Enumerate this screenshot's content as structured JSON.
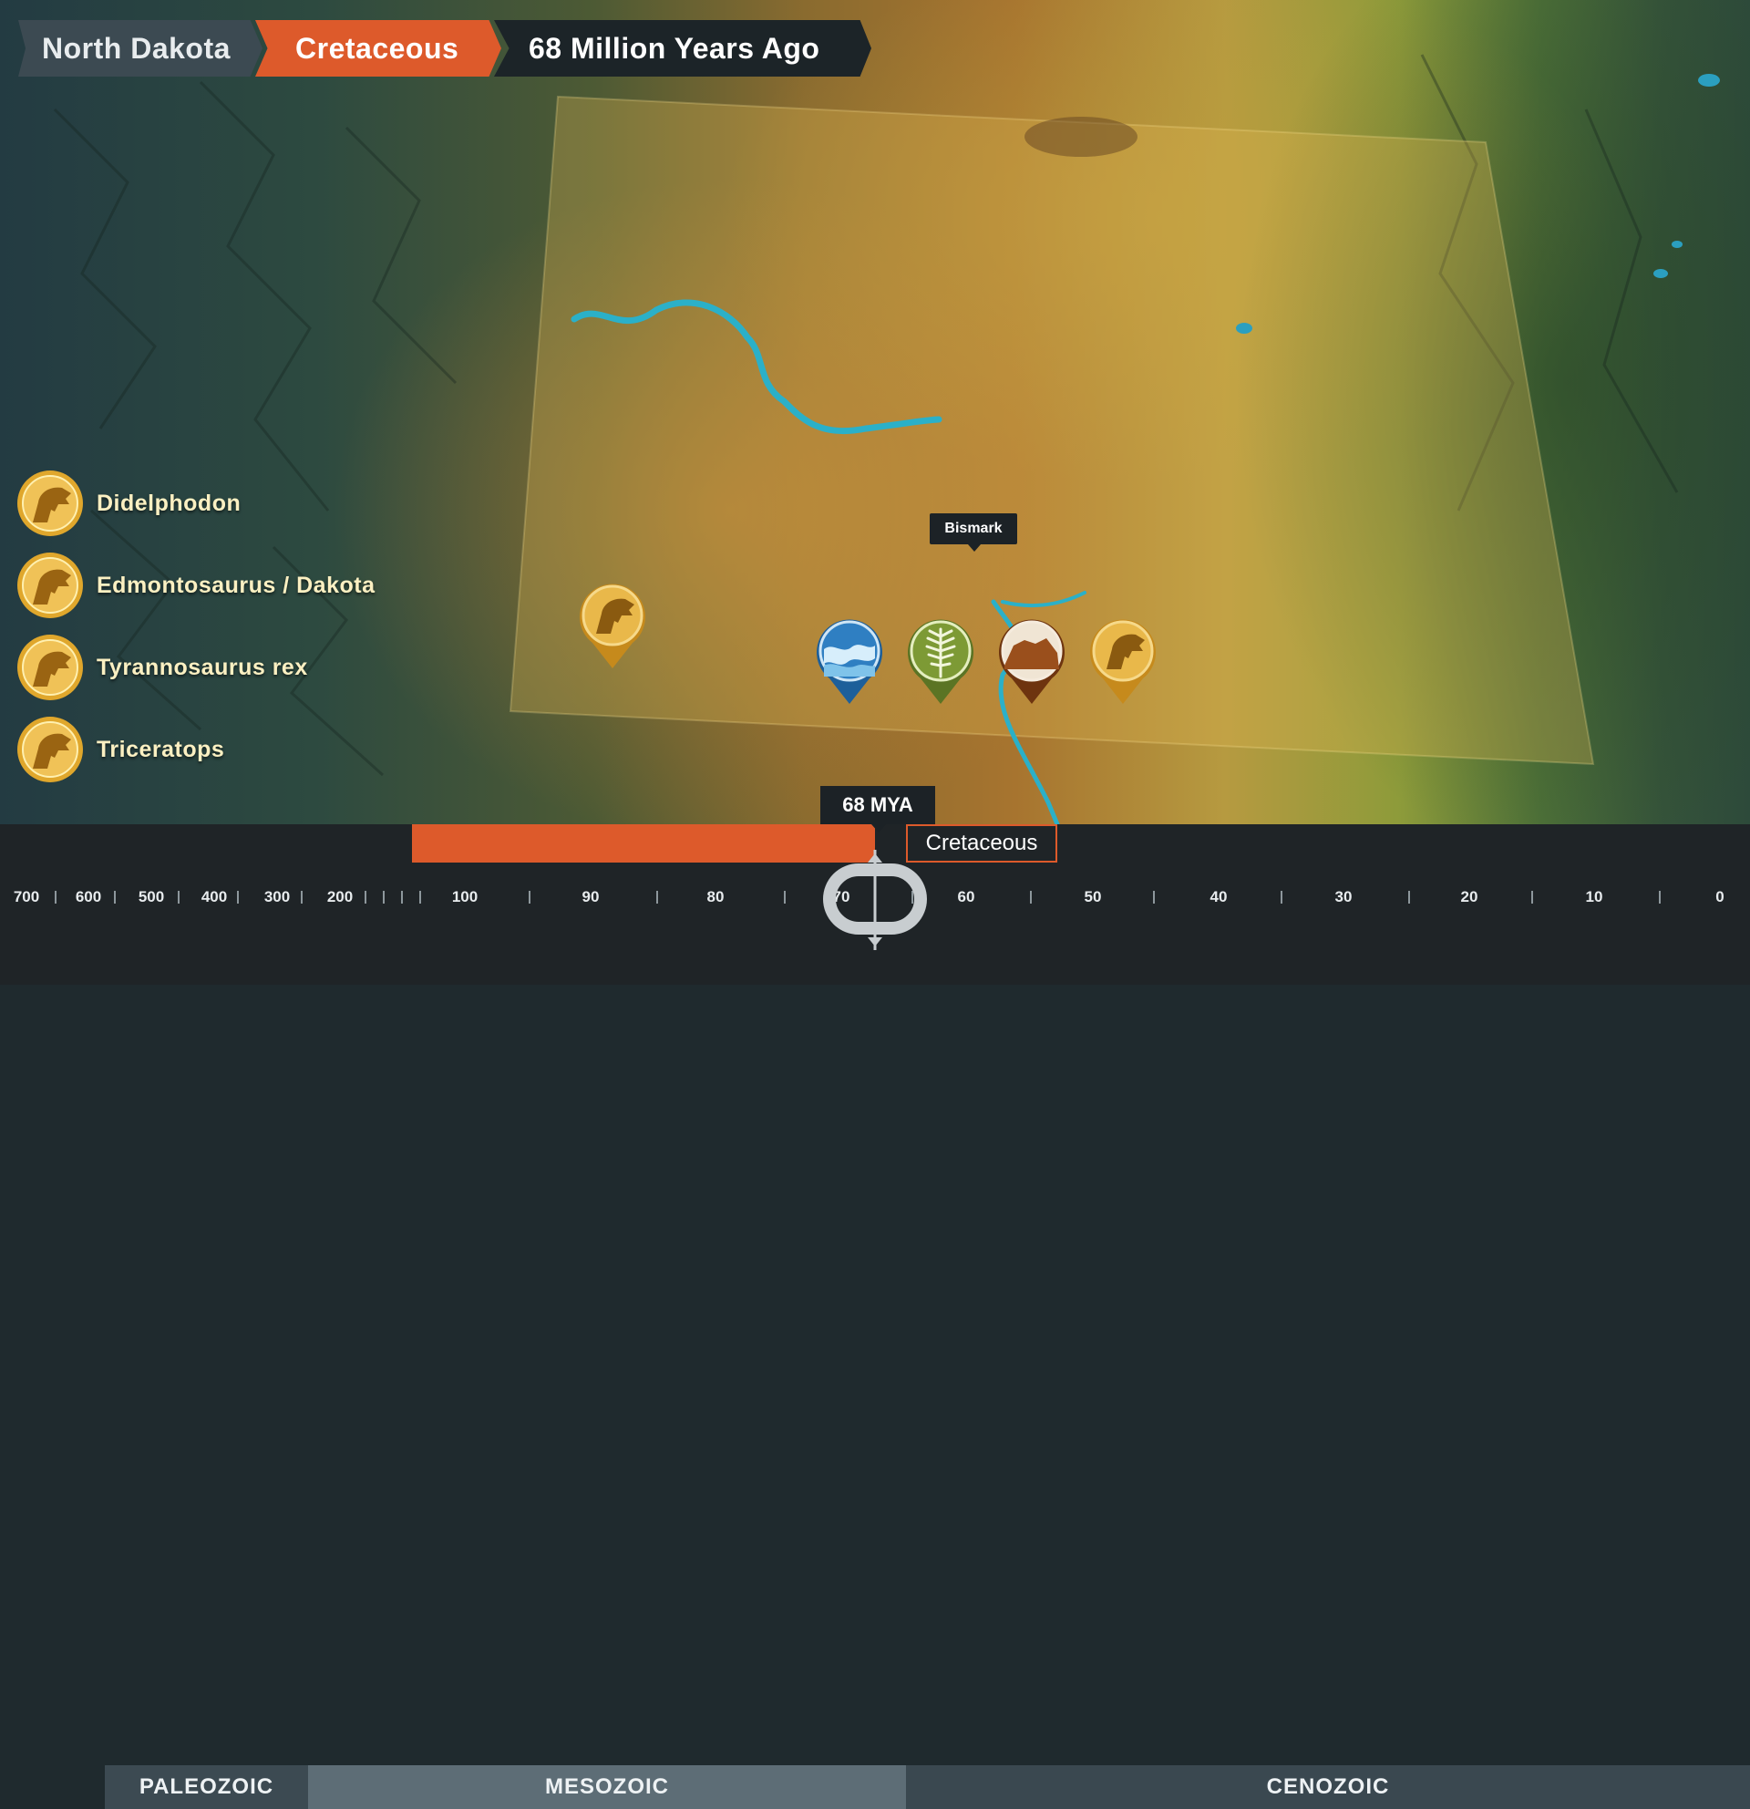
{
  "breadcrumb": {
    "state": "North Dakota",
    "period": "Cretaceous",
    "age": "68 Million Years Ago"
  },
  "legend": {
    "items": [
      {
        "label": "Didelphodon",
        "icon": "dinosaur-head-icon"
      },
      {
        "label": "Edmontosaurus / Dakota",
        "icon": "dinosaur-head-icon"
      },
      {
        "label": "Tyrannosaurus rex",
        "icon": "dinosaur-head-icon"
      },
      {
        "label": "Triceratops",
        "icon": "dinosaur-head-icon"
      }
    ]
  },
  "map": {
    "city_label": "Bismark",
    "pins": [
      {
        "kind": "dinosaur",
        "icon": "dinosaur-head-icon",
        "color": "#e0a72c"
      },
      {
        "kind": "water",
        "icon": "water-wave-icon",
        "color": "#2f7fc2"
      },
      {
        "kind": "plant",
        "icon": "fern-leaf-icon",
        "color": "#7d9a35"
      },
      {
        "kind": "rock",
        "icon": "rock-formation-icon",
        "color": "#9a4f1c"
      },
      {
        "kind": "dinosaur",
        "icon": "dinosaur-head-icon",
        "color": "#e0a72c"
      }
    ]
  },
  "timeline": {
    "current_badge": "68 MYA",
    "current_mya": 68,
    "period_label": "Cretaceous",
    "ticks": [
      "700",
      "600",
      "500",
      "400",
      "300",
      "200",
      "100",
      "90",
      "80",
      "70",
      "60",
      "50",
      "40",
      "30",
      "20",
      "10",
      "0"
    ],
    "eras": [
      {
        "name": "PALEOZOIC"
      },
      {
        "name": "MESOZOIC"
      },
      {
        "name": "CENOZOIC"
      }
    ]
  },
  "colors": {
    "accent": "#dd5a2b",
    "dark_panel": "#1f2427",
    "legend_gold": "#e0a72c",
    "legend_text": "#fbf0c2",
    "river": "#2bb0c8"
  }
}
